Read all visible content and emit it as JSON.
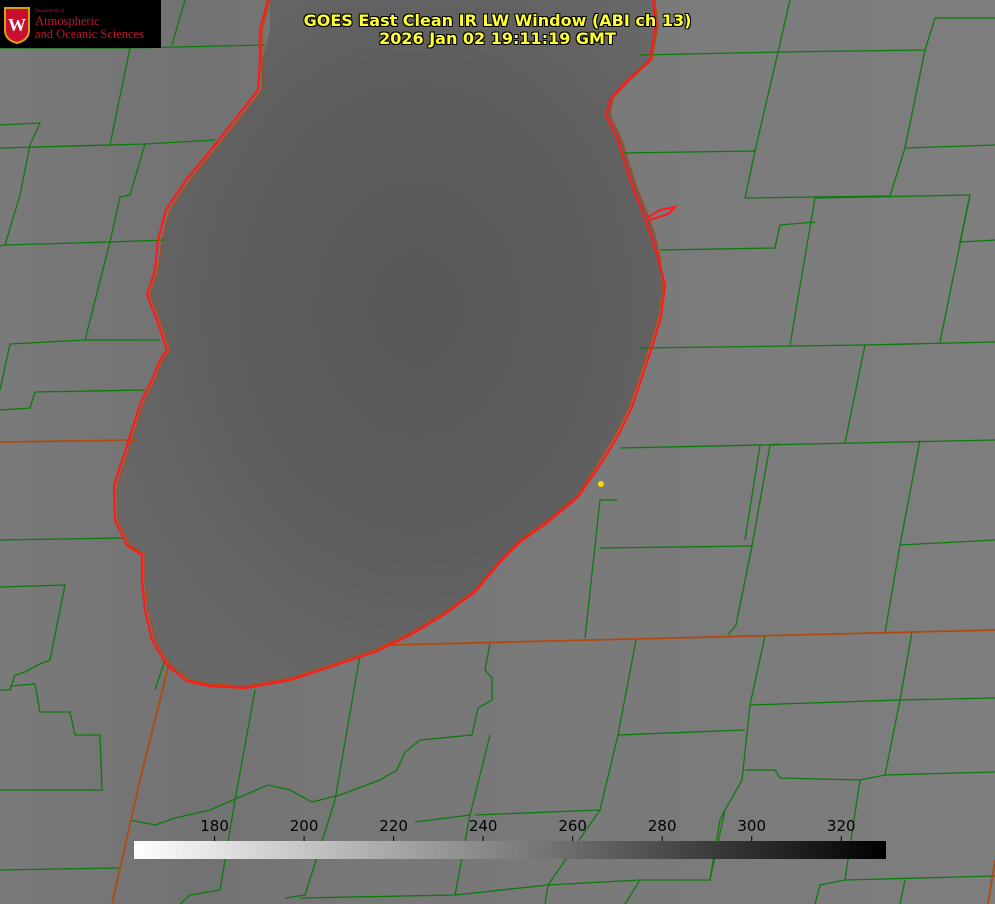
{
  "title": {
    "line1": "GOES East Clean IR LW Window (ABI ch 13)",
    "line2": "2026 Jan 02 19:11:19 GMT"
  },
  "logo": {
    "dept": "Department of",
    "line1": "Atmospheric",
    "line2": "and Oceanic Sciences",
    "seal_letter": "W"
  },
  "colorbar": {
    "ticks": [
      180,
      200,
      220,
      240,
      260,
      280,
      300,
      320
    ],
    "min": 162,
    "max": 330,
    "low_color": "#ffffff",
    "high_color": "#000000"
  },
  "colors": {
    "lake_outline": "#ff1a1a",
    "county_lines": "#0d7a0d",
    "state_lines": "#b04a10",
    "marker": "#ffd700",
    "title_text": "#ffff33",
    "logo_red": "#c8102e"
  }
}
